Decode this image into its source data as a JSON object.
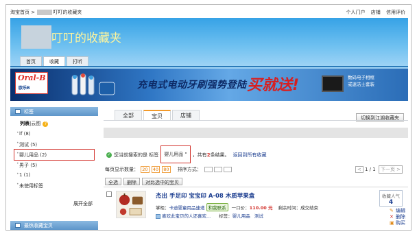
{
  "top": {
    "home": "淘宝首页",
    "sep": ">",
    "crumb_tail": "叮叮的收藏夹",
    "links": [
      "个人门户",
      "店铺",
      "信用评价"
    ]
  },
  "header": {
    "title": "叮叮的收藏夹",
    "nav": [
      "首页",
      "收藏",
      "打听"
    ]
  },
  "ad": {
    "brand": "Oral-B",
    "brand_cn": "欧乐B",
    "headline": "充电式电动牙刷强势登陆",
    "cta": "买就送!",
    "side_line1": "数码电子相框",
    "side_line2": "或速洁士套装"
  },
  "sidebar": {
    "title": "标签",
    "view_list": "列表",
    "view_cloud": "云图",
    "tags": [
      "lf (8)",
      "测试 (5)",
      "婴儿用品 (2)",
      "男子 (5)",
      "1 (1)",
      "未使用标签"
    ],
    "expand": "展开全部",
    "hot_title": "最热收藏宝贝"
  },
  "main": {
    "tabs": [
      "全部",
      "宝贝",
      "店铺"
    ],
    "switch_btn": "切换到江湖收藏夹",
    "note_prefix": "您当前搜索的是 标签",
    "note_tag": "婴儿用品 \"",
    "note_mid_a": "，共有",
    "note_count": "2",
    "note_mid_b": "条结果。",
    "note_back": "返回到所有收藏",
    "perpage_label": "每页显示数量：",
    "perpage_opts": [
      "20",
      "40",
      "80"
    ],
    "sort_label": "排序方式：",
    "pager_text": "1 / 1",
    "prev": "<",
    "next": "下一页 >",
    "actions": [
      "全选",
      "删除",
      "对比选中的宝贝"
    ]
  },
  "item": {
    "title": "杰出 手足印 宝宝印 A-08 木质苹果盒",
    "seller_label": "掌柜：",
    "seller": "卡迪婴童用品速递",
    "ww": "和我联系",
    "price_label": "一口价：",
    "price": "110.00 元",
    "remain": "剩余时间：成交结束",
    "like_text": "喜欢此宝贝的人还喜欢...",
    "tag_label": "标签：",
    "tags": [
      "婴儿用品",
      "测试"
    ],
    "popularity_label": "收藏人气",
    "popularity": "4",
    "ops": [
      "编辑",
      "删除",
      "购买"
    ]
  },
  "colors": {
    "accent_red": "#d2302a",
    "link_blue": "#1a3c8f",
    "tab_orange": "#f29a2a",
    "banner_blue": "#36a2e6"
  }
}
